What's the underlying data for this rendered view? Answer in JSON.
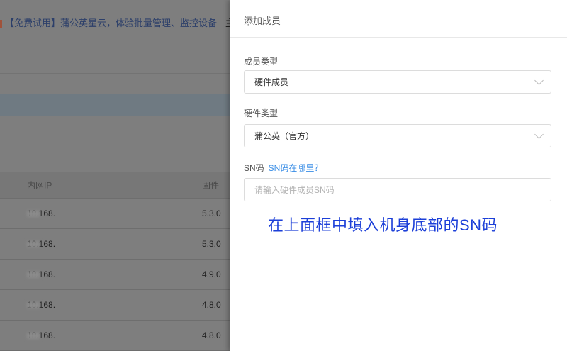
{
  "background": {
    "banner": "【免费试用】蒲公英星云，体验批量管理、监控设备",
    "banner_more": "主",
    "table": {
      "headers": [
        "内网IP",
        "固件"
      ],
      "rows": [
        [
          "10.168.",
          "5.3.0"
        ],
        [
          "10.168.",
          "5.3.0"
        ],
        [
          "10.168.",
          "4.9.0"
        ],
        [
          "10.168.",
          "4.8.0"
        ],
        [
          "10.168.",
          "4.8.0"
        ]
      ]
    }
  },
  "drawer": {
    "title": "添加成员",
    "member_type": {
      "label": "成员类型",
      "value": "硬件成员"
    },
    "hardware_type": {
      "label": "硬件类型",
      "value": "蒲公英（官方）"
    },
    "sn": {
      "label": "SN码",
      "help_link": "SN码在哪里？",
      "placeholder": "请输入硬件成员SN码"
    }
  },
  "annotation": "在上面框中填入机身底部的SN码",
  "colors": {
    "annotation": "#1c3fd8",
    "link": "#3a8ee6"
  }
}
